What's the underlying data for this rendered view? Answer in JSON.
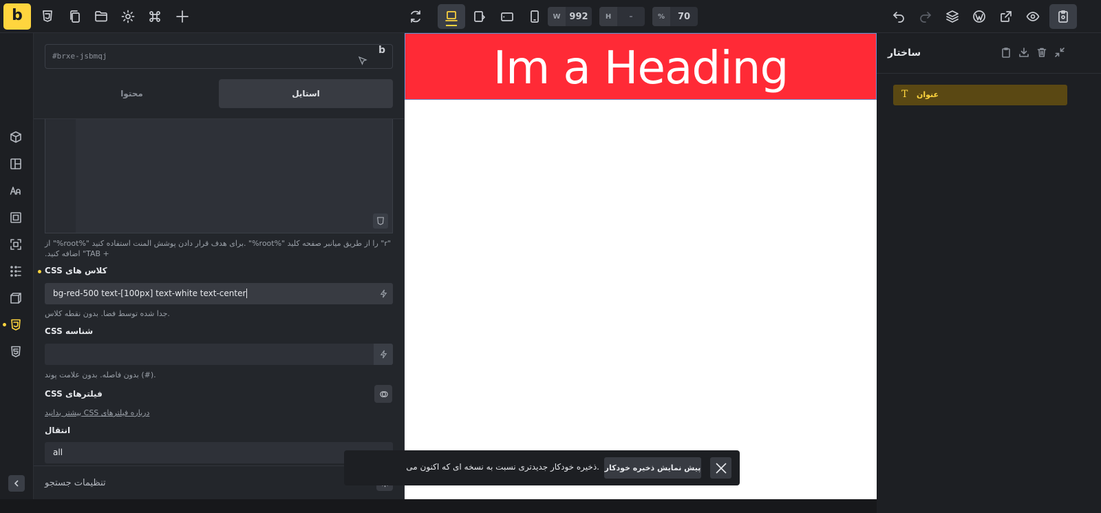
{
  "toolbar": {
    "logo_letter": "b",
    "width_label": "W",
    "width_value": "992",
    "height_label": "H",
    "height_value": "-",
    "zoom_label": "%",
    "zoom_value": "70"
  },
  "settings": {
    "element_id": "#brxe-jsbmqj",
    "element_badge": "b",
    "tabs": [
      "محتوا",
      "استایل"
    ],
    "active_tab": "استایل",
    "css_help": "\"r\" را از طریق میانبر صفحه کلید \"%root%\" .برای هدف قرار دادن پوشش المنت استفاده کنید \"%root%\" از + TAB\" اضافه کنید.",
    "css_classes_label": "CSS کلاس های",
    "css_classes_value": "bg-red-500 text-[100px] text-white text-center",
    "css_classes_help": ".جدا شده توسط فضا. بدون نقطه کلاس",
    "css_id_label": "CSS شناسه",
    "css_id_value": "",
    "css_id_help": ".(#) بدون فاصله. بدون علامت پوند",
    "css_filters_label": "CSS فیلترهای",
    "css_filters_link": "بیشتر بدانید CSS درباره فیلترهای",
    "transition_label": "انتقال",
    "transition_value": "all",
    "footer_label": "تنظیمات جستجو"
  },
  "canvas": {
    "heading_text": "Im a Heading",
    "heading_bg": "#ff2a36"
  },
  "toast": {
    "message": ".ذخیره خودکار جدیدتری نسبت به نسخه ای که اکنون می",
    "button_label": "پیش نمایش ذخیره خودکار"
  },
  "structure": {
    "title": "ساختار",
    "items": [
      {
        "label": "عنوان",
        "icon": "text-icon"
      }
    ]
  },
  "colors": {
    "accent": "#ffd53e",
    "panel_bg": "#23262b",
    "heading_red": "#ff2a36"
  }
}
